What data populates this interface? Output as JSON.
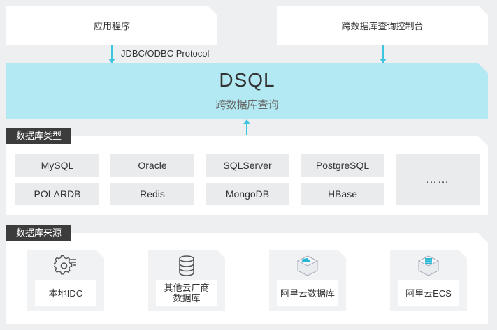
{
  "top": {
    "app_label": "应用程序",
    "console_label": "跨数据库查询控制台",
    "protocol_label": "JDBC/ODBC Protocol"
  },
  "dsql": {
    "title": "DSQL",
    "subtitle": "跨数据库查询"
  },
  "db_types": {
    "tag": "数据库类型",
    "row1": [
      "MySQL",
      "Oracle",
      "SQLServer",
      "PostgreSQL"
    ],
    "row2": [
      "POLARDB",
      "Redis",
      "MongoDB",
      "HBase"
    ],
    "more": "……"
  },
  "db_sources": {
    "tag": "数据库来源",
    "items": [
      {
        "label_line1": "本地IDC",
        "label_line2": "",
        "icon": "gear-icon"
      },
      {
        "label_line1": "其他云厂商",
        "label_line2": "数据库",
        "icon": "database-icon"
      },
      {
        "label_line1": "阿里云数据库",
        "label_line2": "",
        "icon": "cloud-database-icon"
      },
      {
        "label_line1": "阿里云ECS",
        "label_line2": "",
        "icon": "ecs-server-icon"
      }
    ]
  },
  "colors": {
    "accent": "#3ec6e0",
    "dsql_band": "#b3e9f2",
    "tag_bg": "#3c3c3c"
  }
}
